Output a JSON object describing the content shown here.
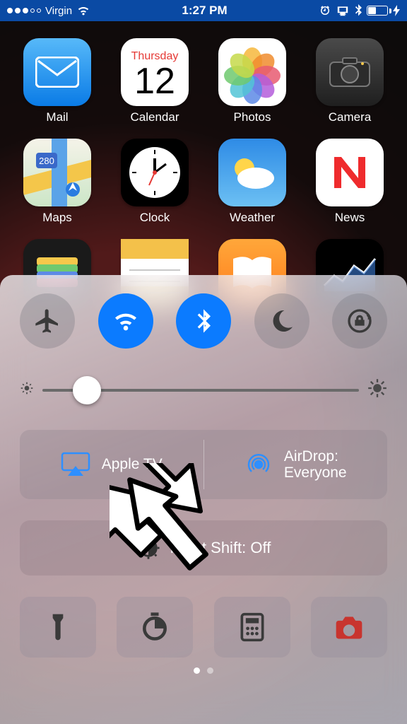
{
  "status": {
    "carrier": "Virgin",
    "time": "1:27 PM"
  },
  "home_apps": {
    "row1": [
      {
        "label": "Mail"
      },
      {
        "label": "Calendar"
      },
      {
        "label": "Photos"
      },
      {
        "label": "Camera"
      }
    ],
    "row2": [
      {
        "label": "Maps"
      },
      {
        "label": "Clock"
      },
      {
        "label": "Weather"
      },
      {
        "label": "News"
      }
    ],
    "calendar": {
      "weekday": "Thursday",
      "day": "12"
    }
  },
  "control_center": {
    "airplay_label": "Apple TV",
    "airdrop_line1": "AirDrop:",
    "airdrop_line2": "Everyone",
    "nightshift_label": "Night Shift: Off"
  }
}
